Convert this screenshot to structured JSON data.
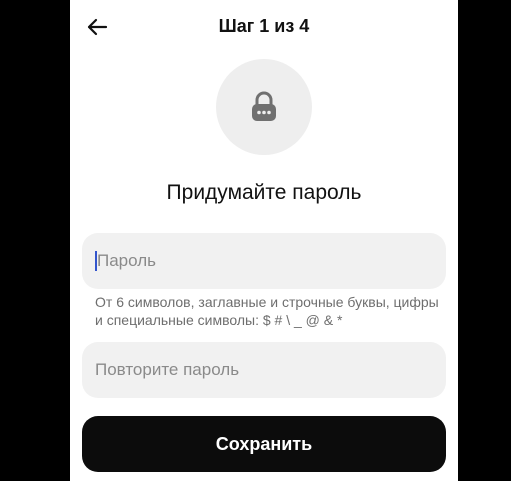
{
  "header": {
    "step": "Шаг 1 из 4",
    "back_icon": "arrow-left-icon"
  },
  "lock": {
    "icon": "lock-icon"
  },
  "title": "Придумайте пароль",
  "password_field": {
    "placeholder": "Пароль",
    "value": ""
  },
  "hint": "От 6 символов, заглавные и строчные буквы, цифры и специальные символы: $ # \\ _ @ & *",
  "repeat_field": {
    "placeholder": "Повторите пароль",
    "value": ""
  },
  "save_button": {
    "label": "Сохранить"
  },
  "colors": {
    "button_bg": "#0c0c0c",
    "field_bg": "#f1f1f1",
    "cursor": "#3355cc"
  }
}
